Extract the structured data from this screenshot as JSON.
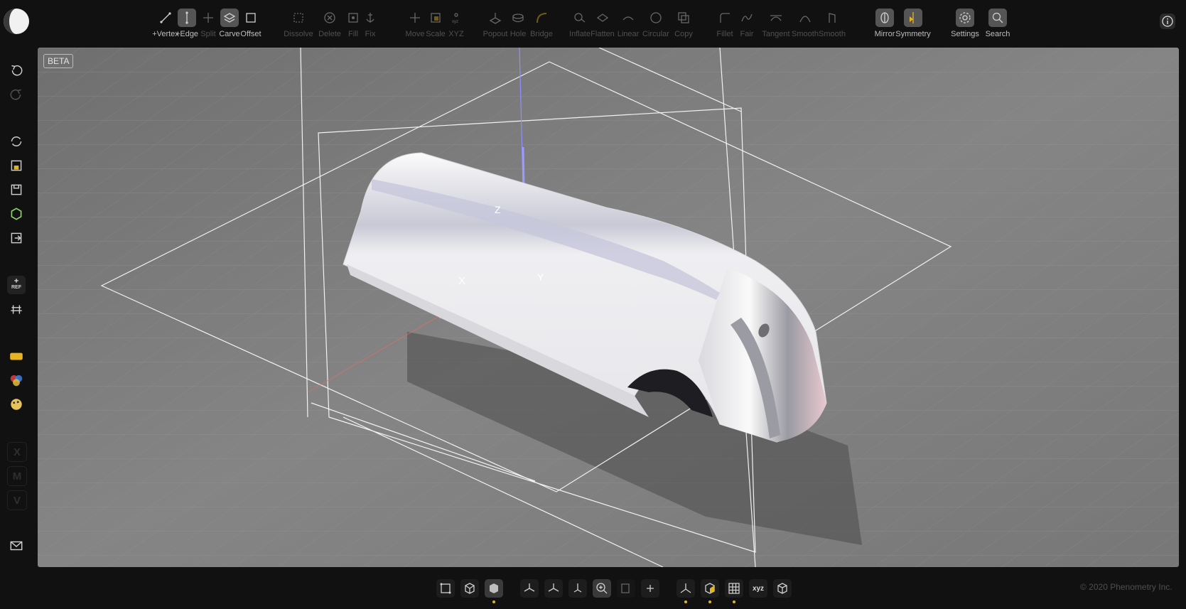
{
  "app": {
    "logo_icon": "half-moon-logo-icon",
    "info_icon": "info-icon",
    "beta_label": "BETA"
  },
  "toolbar": {
    "tools": [
      {
        "label": "+Vertex",
        "icon": "add-vertex-icon",
        "state": "normal"
      },
      {
        "label": "+Edge",
        "icon": "add-edge-icon",
        "state": "active"
      },
      {
        "label": "Split",
        "icon": "split-icon",
        "state": "dim"
      },
      {
        "label": "Carve",
        "icon": "carve-icon",
        "state": "active"
      },
      {
        "label": "Offset",
        "icon": "offset-icon",
        "state": "normal"
      },
      {
        "label": "Dissolve",
        "icon": "dissolve-icon",
        "state": "dim"
      },
      {
        "label": "Delete",
        "icon": "delete-icon",
        "state": "dim"
      },
      {
        "label": "Fill",
        "icon": "fill-icon",
        "state": "dim"
      },
      {
        "label": "Fix",
        "icon": "anchor-icon",
        "state": "dim"
      },
      {
        "label": "Move",
        "icon": "move-icon",
        "state": "dim"
      },
      {
        "label": "Scale",
        "icon": "scale-icon",
        "state": "dim"
      },
      {
        "label": "XYZ",
        "icon": "xyz-icon",
        "state": "dim"
      },
      {
        "label": "Popout",
        "icon": "popout-icon",
        "state": "dim"
      },
      {
        "label": "Hole",
        "icon": "hole-icon",
        "state": "dim"
      },
      {
        "label": "Bridge",
        "icon": "bridge-icon",
        "state": "dim"
      },
      {
        "label": "Inflate",
        "icon": "inflate-icon",
        "state": "dim"
      },
      {
        "label": "Flatten",
        "icon": "flatten-icon",
        "state": "dim"
      },
      {
        "label": "Linear",
        "icon": "linear-icon",
        "state": "dim"
      },
      {
        "label": "Circular",
        "icon": "circular-icon",
        "state": "dim"
      },
      {
        "label": "Copy",
        "icon": "copy-icon",
        "state": "dim"
      },
      {
        "label": "Fillet",
        "icon": "fillet-icon",
        "state": "dim"
      },
      {
        "label": "Fair",
        "icon": "fair-icon",
        "state": "dim"
      },
      {
        "label": "Tangent",
        "icon": "tangent-icon",
        "state": "dim"
      },
      {
        "label": "Smooth",
        "icon": "smooth-curve-icon",
        "state": "dim"
      },
      {
        "label": "Smooth",
        "icon": "smooth-surface-icon",
        "state": "dim"
      },
      {
        "label": "Mirror",
        "icon": "mirror-icon",
        "state": "active"
      },
      {
        "label": "Symmetry",
        "icon": "symmetry-icon",
        "state": "active"
      },
      {
        "label": "Settings",
        "icon": "gear-icon",
        "state": "active"
      },
      {
        "label": "Search",
        "icon": "search-icon",
        "state": "active"
      }
    ]
  },
  "sidebar": {
    "items": [
      {
        "icon": "undo-icon",
        "state": "normal"
      },
      {
        "icon": "redo-icon",
        "state": "dim"
      },
      {
        "icon": "reload-icon",
        "state": "normal"
      },
      {
        "icon": "import-icon",
        "state": "normal"
      },
      {
        "icon": "save-icon",
        "state": "normal"
      },
      {
        "icon": "export-3d-icon",
        "state": "normal"
      },
      {
        "icon": "exit-icon",
        "state": "normal"
      },
      {
        "icon": "add-ref-icon",
        "state": "normal",
        "text": "REF"
      },
      {
        "icon": "ref-plane-icon",
        "state": "normal"
      },
      {
        "icon": "material-swatch-icon",
        "state": "normal"
      },
      {
        "icon": "color-wheel-icon",
        "state": "normal"
      },
      {
        "icon": "palette-icon",
        "state": "normal"
      },
      {
        "icon": "x-key-icon",
        "state": "dim",
        "text": "X"
      },
      {
        "icon": "m-key-icon",
        "state": "dim",
        "text": "M"
      },
      {
        "icon": "v-key-icon",
        "state": "dim",
        "text": "V"
      },
      {
        "icon": "mail-icon",
        "state": "normal"
      }
    ]
  },
  "viewport": {
    "axis_labels": {
      "x": "X",
      "y": "Y",
      "z": "Z"
    },
    "colors": {
      "background": "#7f7f7f",
      "grid": "#9a9a9a",
      "x_axis": "#e86a6a",
      "z_axis": "#8f8fff",
      "model": "#e9e9ec"
    }
  },
  "bottom_toolbar": {
    "tools": [
      {
        "icon": "select-vertices-icon",
        "state": "normal",
        "dot": false
      },
      {
        "icon": "wireframe-cube-icon",
        "state": "normal",
        "dot": false
      },
      {
        "icon": "solid-cube-icon",
        "state": "active",
        "dot": true
      },
      {
        "icon": "view-x-icon",
        "state": "normal",
        "dot": false
      },
      {
        "icon": "view-y-icon",
        "state": "normal",
        "dot": false
      },
      {
        "icon": "view-z-icon",
        "state": "normal",
        "dot": false
      },
      {
        "icon": "zoom-icon",
        "state": "active",
        "dot": false
      },
      {
        "icon": "section-view-icon",
        "state": "dim",
        "dot": false
      },
      {
        "icon": "add-point-icon",
        "state": "normal",
        "dot": false
      },
      {
        "icon": "axes-icon",
        "state": "normal",
        "dot": true
      },
      {
        "icon": "shaded-box-icon",
        "state": "normal",
        "dot": true
      },
      {
        "icon": "grid-icon",
        "state": "normal",
        "dot": true
      },
      {
        "icon": "xyz-toggle-icon",
        "state": "normal",
        "dot": false,
        "text": "xyz"
      },
      {
        "icon": "reference-box-icon",
        "state": "normal",
        "dot": false
      }
    ],
    "copyright": "© 2020 Phenometry Inc."
  }
}
